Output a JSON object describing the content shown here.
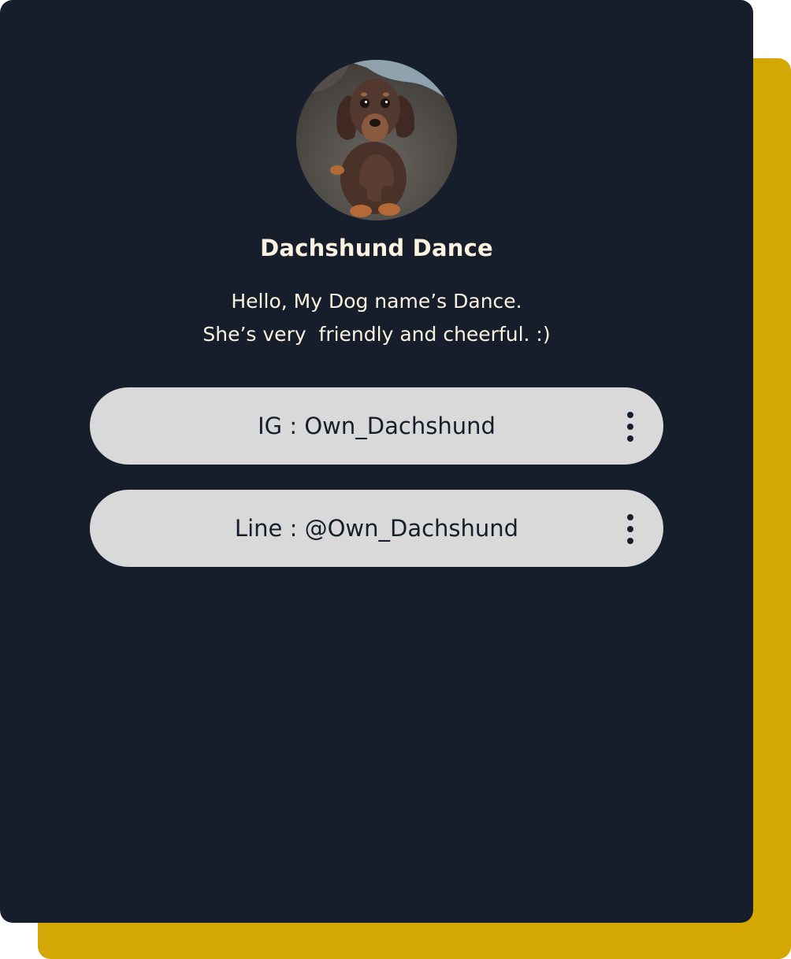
{
  "profile": {
    "name": "Dachshund Dance",
    "bio_line1": "Hello, My Dog name’s Dance.",
    "bio_line2": "She’s very  friendly and cheerful. :)",
    "avatar_icon": "dachshund-photo"
  },
  "links": [
    {
      "label": "IG : Own_Dachshund",
      "menu_icon": "more-vertical-icon"
    },
    {
      "label": "Line : @Own_Dachshund",
      "menu_icon": "more-vertical-icon"
    }
  ],
  "colors": {
    "card_background": "#171e2b",
    "accent_backplate": "#d4a804",
    "button_background": "#d9d9d9",
    "heading_text": "#fbf3df"
  }
}
